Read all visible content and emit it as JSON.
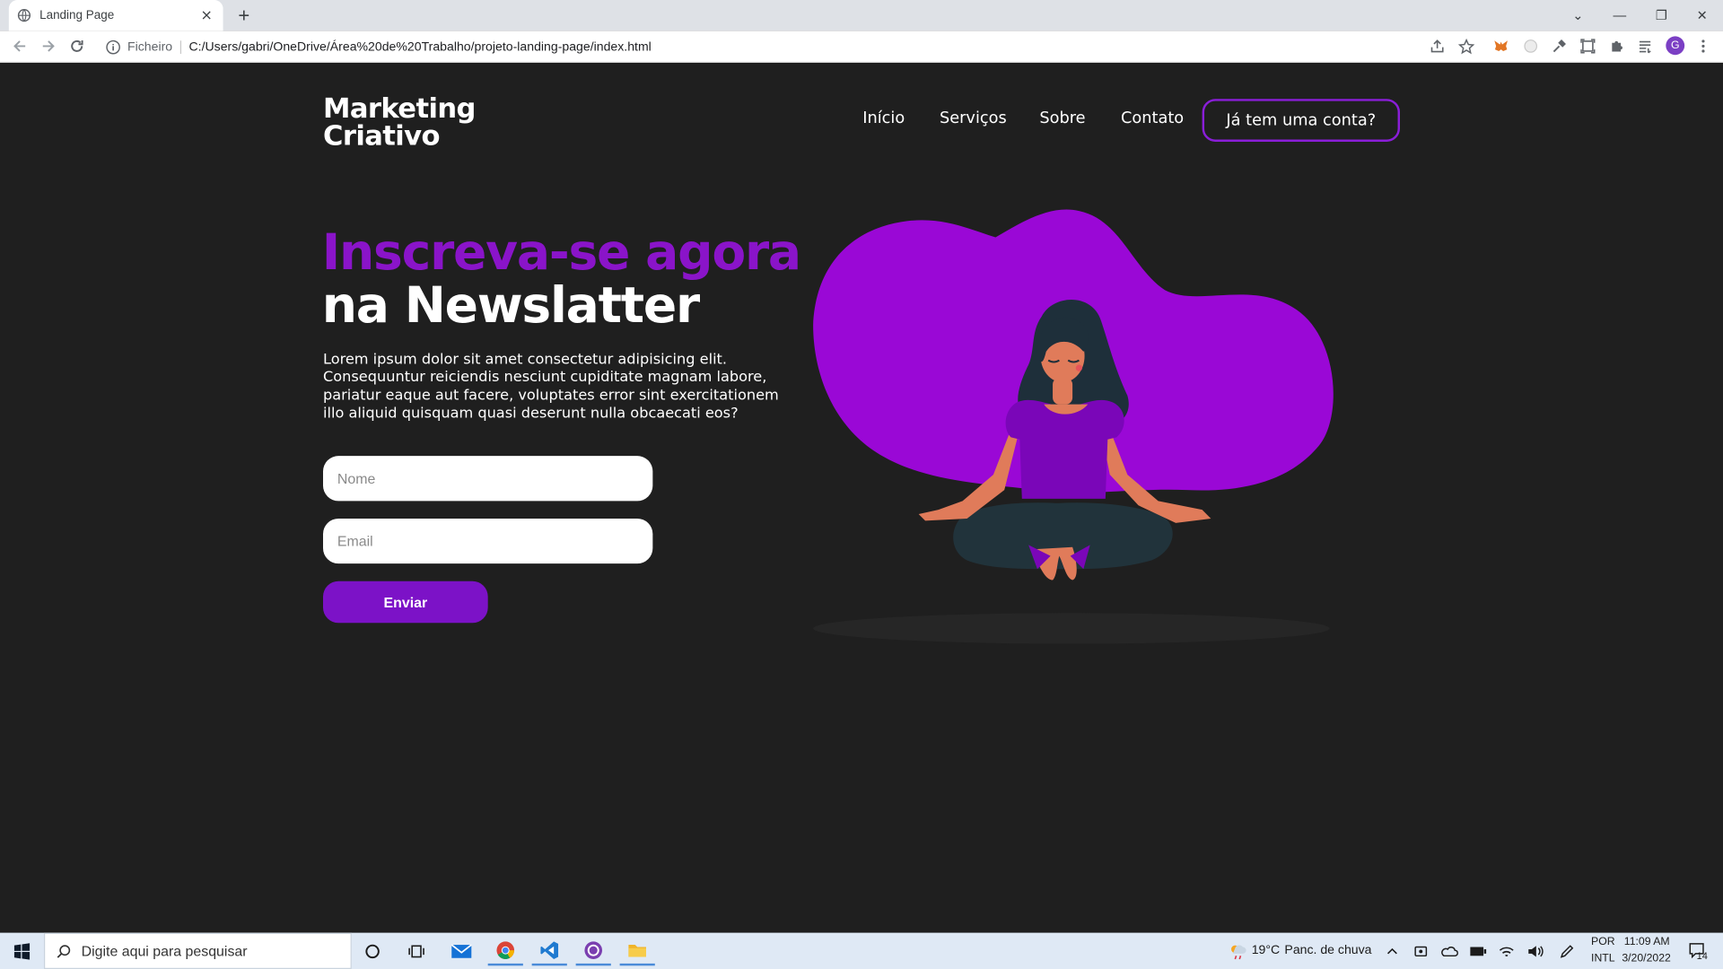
{
  "browser": {
    "tab_title": "Landing Page",
    "tab_close": "×",
    "new_tab": "+",
    "window_controls": {
      "tab_search": "⌄",
      "minimize": "—",
      "restore": "❐",
      "close": "✕"
    },
    "scheme_label": "Ficheiro",
    "url": "C:/Users/gabri/OneDrive/Área%20de%20Trabalho/projeto-landing-page/index.html",
    "profile_initial": "G"
  },
  "header": {
    "logo_line1": "Marketing",
    "logo_line2": "Criativo",
    "nav": [
      "Início",
      "Serviços",
      "Sobre",
      "Contato"
    ],
    "login_button": "Já tem uma conta?"
  },
  "hero": {
    "title_line1": "Inscreva-se agora",
    "title_line2": "na Newslatter",
    "description": "Lorem ipsum dolor sit amet consectetur adipisicing elit. Consequuntur reiciendis nesciunt cupiditate magnam labore, pariatur eaque aut facere, voluptates error sint exercitationem illo aliquid quisquam quasi deserunt nulla obcaecati eos?",
    "name_placeholder": "Nome",
    "email_placeholder": "Email",
    "submit_label": "Enviar"
  },
  "colors": {
    "accent": "#8a14c9",
    "button": "#7c12c7",
    "background": "#1f1f1f",
    "blob": "#9a08d6"
  },
  "taskbar": {
    "search_placeholder": "Digite aqui para pesquisar",
    "weather_temp": "19°C",
    "weather_desc": "Panc. de chuva",
    "lang_top": "POR",
    "lang_bottom": "INTL",
    "time": "11:09 AM",
    "date": "3/20/2022",
    "notification_count": "14"
  }
}
